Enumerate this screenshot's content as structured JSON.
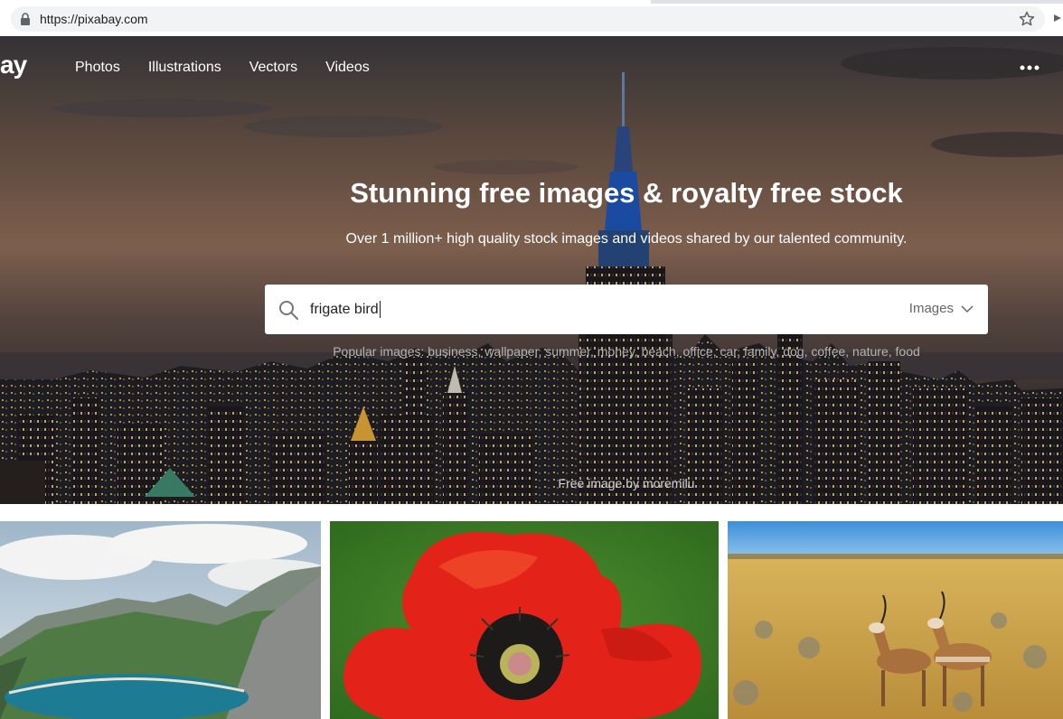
{
  "browser": {
    "url": "https://pixabay.com"
  },
  "header": {
    "logo_text": "ay",
    "nav": [
      {
        "label": "Photos"
      },
      {
        "label": "Illustrations"
      },
      {
        "label": "Vectors"
      },
      {
        "label": "Videos"
      }
    ],
    "more_icon": "more-dots-icon"
  },
  "hero": {
    "title": "Stunning free images & royalty free stock",
    "subtitle": "Over 1 million+ high quality stock images and videos shared by our talented community.",
    "search": {
      "value": "frigate bird",
      "type_label": "Images"
    },
    "popular_label": "Popular images:",
    "popular_tags": "business, wallpaper, summer, money, beach, office, car, family, dog, coffee, nature, food",
    "credit": "Free image by moremilu"
  },
  "icons": {
    "lock": "lock-icon",
    "star": "star-icon",
    "search": "search-icon",
    "chevron": "chevron-down-icon"
  },
  "colors": {
    "accent_white": "#ffffff",
    "search_text": "#222222",
    "muted": "#666666"
  }
}
